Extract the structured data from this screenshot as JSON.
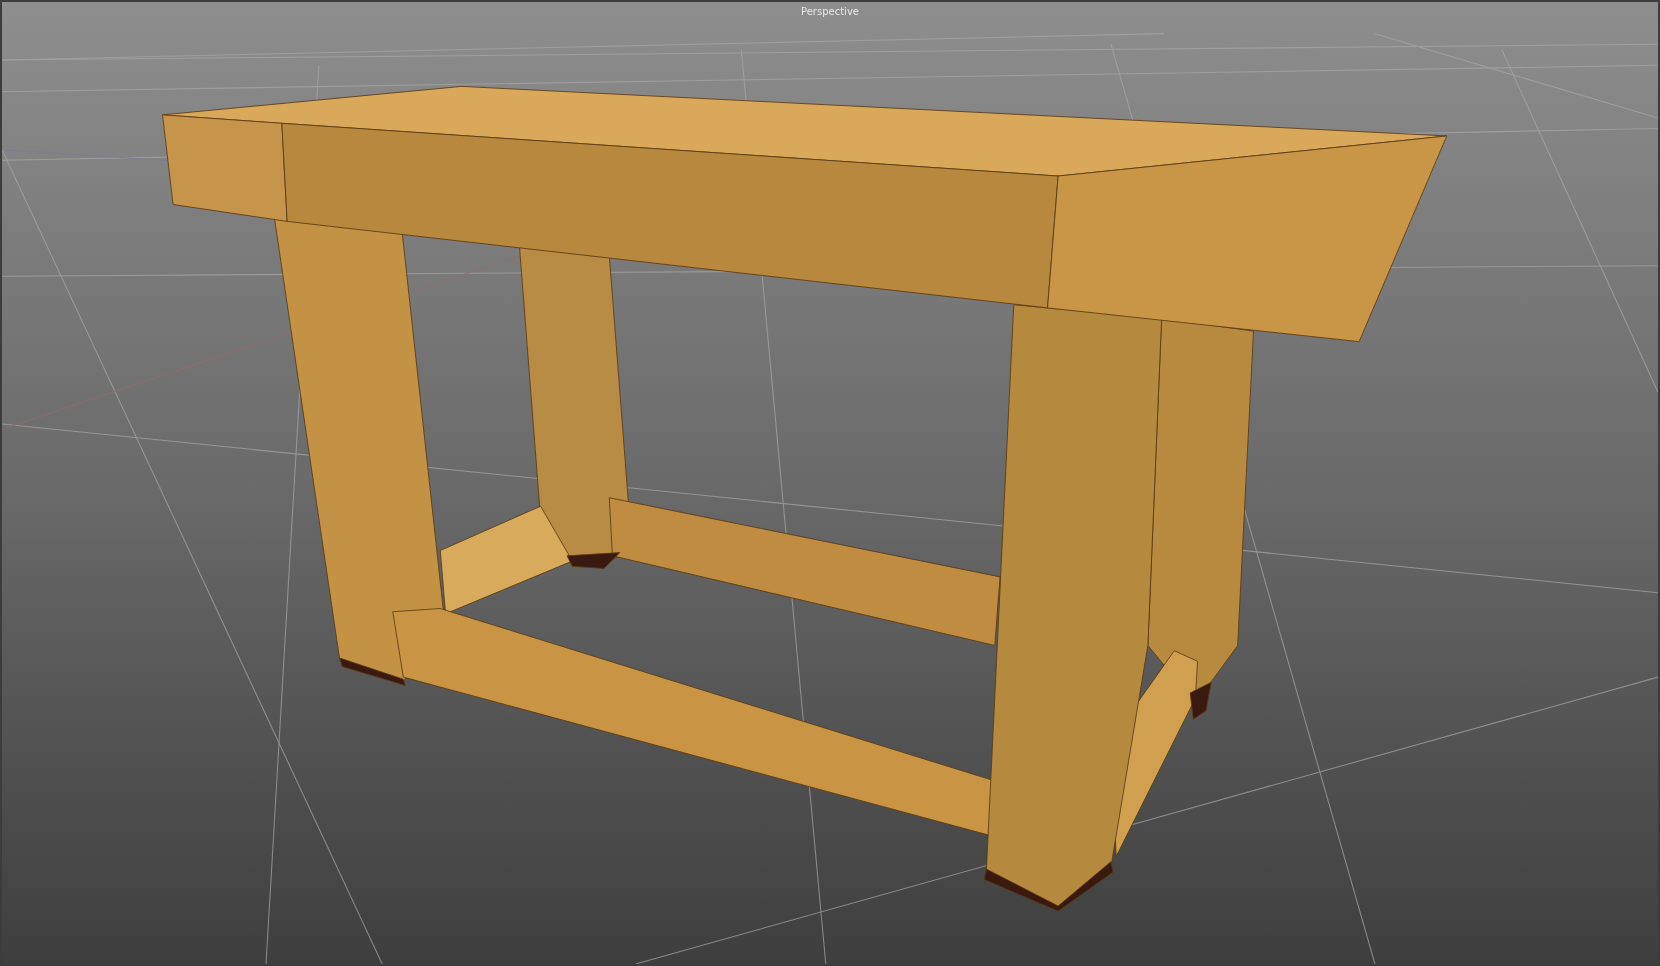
{
  "viewport": {
    "title": "Perspective"
  }
}
